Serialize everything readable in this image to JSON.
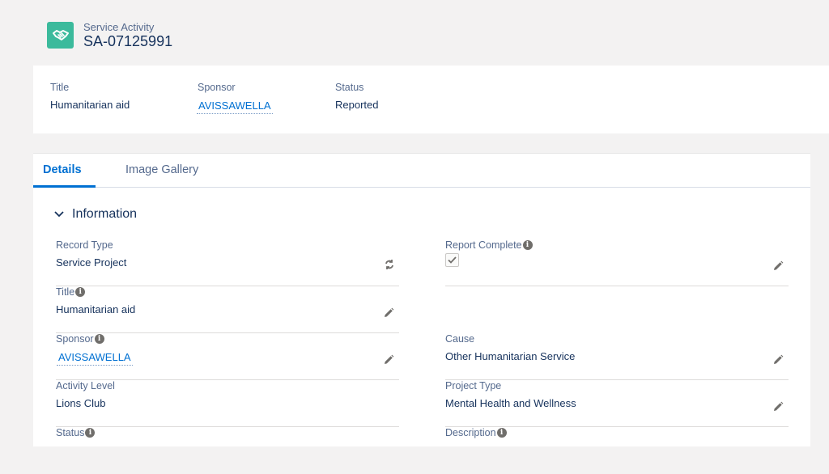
{
  "header": {
    "object_type": "Service Activity",
    "record_name": "SA-07125991",
    "icon": "handshake-icon",
    "icon_color": "#3bba9c"
  },
  "highlights": {
    "title_label": "Title",
    "title_value": "Humanitarian aid",
    "sponsor_label": "Sponsor",
    "sponsor_value": "AVISSAWELLA",
    "status_label": "Status",
    "status_value": "Reported"
  },
  "tabs": [
    {
      "label": "Details",
      "active": true
    },
    {
      "label": "Image Gallery",
      "active": false
    }
  ],
  "section": {
    "title": "Information"
  },
  "fields": {
    "record_type": {
      "label": "Record Type",
      "value": "Service Project"
    },
    "report_complete": {
      "label": "Report Complete",
      "checked": true
    },
    "title": {
      "label": "Title",
      "value": "Humanitarian aid"
    },
    "sponsor": {
      "label": "Sponsor",
      "value": "AVISSAWELLA"
    },
    "cause": {
      "label": "Cause",
      "value": "Other Humanitarian Service"
    },
    "activity_level": {
      "label": "Activity Level",
      "value": "Lions Club"
    },
    "project_type": {
      "label": "Project Type",
      "value": "Mental Health and Wellness"
    },
    "status": {
      "label": "Status"
    },
    "description": {
      "label": "Description"
    }
  },
  "colors": {
    "accent": "#0070d2",
    "text_dark": "#16325c",
    "label": "#54698d"
  }
}
